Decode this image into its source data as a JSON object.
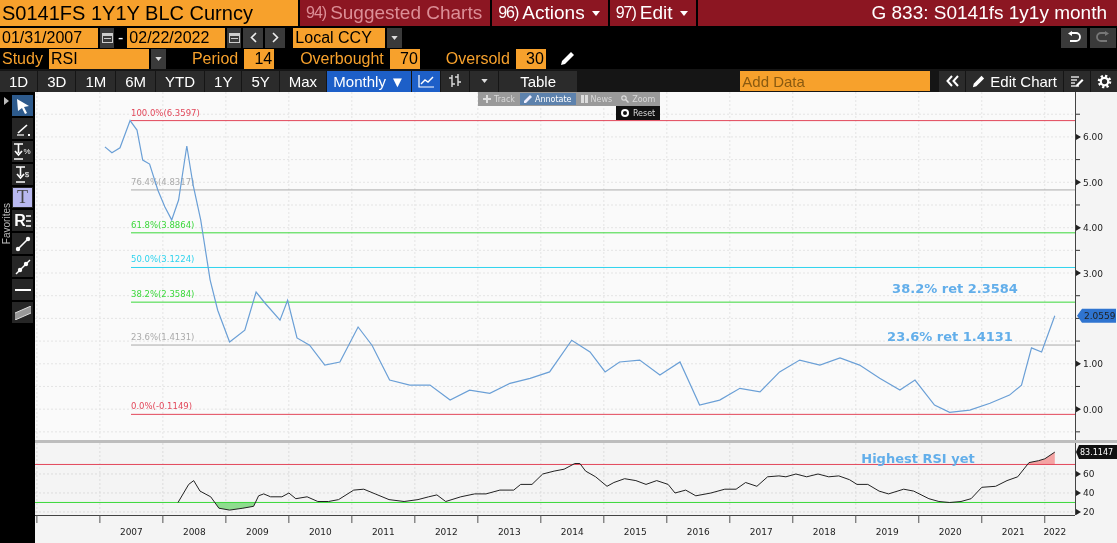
{
  "header": {
    "ticker": "S0141FS 1Y1Y BLC Curncy",
    "menus": [
      {
        "num": "94)",
        "label": "Suggested Charts",
        "disabled": true,
        "dropdown": false
      },
      {
        "num": "96)",
        "label": "Actions",
        "disabled": false,
        "dropdown": true
      },
      {
        "num": "97)",
        "label": "Edit",
        "disabled": false,
        "dropdown": true
      }
    ],
    "title": "G 833: S0141fs 1y1y month"
  },
  "dates": {
    "start": "01/31/2007",
    "separator": "-",
    "end": "02/22/2022",
    "currency": "Local CCY"
  },
  "study": {
    "label": "Study",
    "name": "RSI",
    "params": [
      {
        "label": "Period",
        "value": "14"
      },
      {
        "label": "Overbought",
        "value": "70"
      },
      {
        "label": "Oversold",
        "value": "30"
      }
    ]
  },
  "ranges": [
    {
      "label": "1D",
      "selected": false
    },
    {
      "label": "3D",
      "selected": false
    },
    {
      "label": "1M",
      "selected": false
    },
    {
      "label": "6M",
      "selected": false
    },
    {
      "label": "YTD",
      "selected": false
    },
    {
      "label": "1Y",
      "selected": false
    },
    {
      "label": "5Y",
      "selected": false
    },
    {
      "label": "Max",
      "selected": false
    }
  ],
  "frequency": {
    "label": "Monthly ▼",
    "selected": true
  },
  "chart_types": [
    {
      "kind": "line",
      "selected": true
    },
    {
      "kind": "bar",
      "selected": false
    }
  ],
  "table_button": "Table",
  "add_data": {
    "placeholder": "Add Data"
  },
  "edit_chart": "Edit Chart",
  "favorites": "Favorites",
  "tools": [
    {
      "kind": "pointer",
      "selected": true
    },
    {
      "kind": "pen",
      "selected": false
    },
    {
      "kind": "price",
      "glyph": "%",
      "selected": false
    },
    {
      "kind": "price",
      "glyph": "$",
      "selected": false
    },
    {
      "kind": "text",
      "glyph": "T",
      "selected": false
    },
    {
      "kind": "label",
      "glyph": "R",
      "selected": false
    },
    {
      "kind": "trend",
      "selected": false
    },
    {
      "kind": "ray",
      "selected": false
    },
    {
      "kind": "horizontal",
      "selected": false
    },
    {
      "kind": "channel",
      "selected": false
    }
  ],
  "chart_modes": [
    {
      "kind": "track",
      "label": "Track",
      "selected": false
    },
    {
      "kind": "annotate",
      "label": "Annotate",
      "selected": true
    },
    {
      "kind": "news",
      "label": "News",
      "selected": false
    },
    {
      "kind": "zoom",
      "label": "Zoom",
      "selected": false
    }
  ],
  "reset": "Reset",
  "main_chart": {
    "last_value": "2.0559",
    "chart_data": {
      "type": "line",
      "grid": true,
      "xlim": [
        2005.97,
        2022.48
      ],
      "ylim": [
        -0.68,
        6.99
      ],
      "yticks": [
        {
          "value": 0,
          "label": "0.00"
        },
        {
          "value": 1,
          "label": "1.00"
        },
        {
          "value": 3,
          "label": "3.00"
        },
        {
          "value": 4,
          "label": "4.00"
        },
        {
          "value": 5,
          "label": "5.00"
        },
        {
          "value": 6,
          "label": "6.00"
        }
      ],
      "x": [
        2007.08,
        2007.19,
        2007.32,
        2007.48,
        2007.59,
        2007.68,
        2007.79,
        2007.92,
        2008.03,
        2008.14,
        2008.25,
        2008.38,
        2008.48,
        2008.6,
        2008.75,
        2008.87,
        2009.06,
        2009.3,
        2009.48,
        2009.62,
        2009.86,
        2009.98,
        2010.13,
        2010.33,
        2010.57,
        2010.81,
        2011.1,
        2011.32,
        2011.6,
        2011.92,
        2012.24,
        2012.56,
        2012.87,
        2013.19,
        2013.51,
        2013.83,
        2014.14,
        2014.49,
        2014.78,
        2015.02,
        2015.25,
        2015.57,
        2015.89,
        2016.21,
        2016.52,
        2016.84,
        2017.16,
        2017.48,
        2017.79,
        2018.11,
        2018.43,
        2018.75,
        2019.06,
        2019.38,
        2019.7,
        2019.94,
        2020.25,
        2020.49,
        2020.81,
        2021.13,
        2021.44,
        2021.63,
        2021.79,
        2021.95,
        2022.16
      ],
      "series": [
        {
          "color": "#6a9fd6",
          "values": [
            5.78,
            5.65,
            5.76,
            6.36,
            6.15,
            5.49,
            5.4,
            4.83,
            4.46,
            4.17,
            4.61,
            5.8,
            4.94,
            4.17,
            2.85,
            2.18,
            1.48,
            1.74,
            2.58,
            2.34,
            1.96,
            2.4,
            1.57,
            1.41,
            0.97,
            1.04,
            1.81,
            1.41,
            0.64,
            0.53,
            0.53,
            0.2,
            0.42,
            0.35,
            0.57,
            0.68,
            0.82,
            1.52,
            1.26,
            0.82,
            1.04,
            1.08,
            0.75,
            1.04,
            0.09,
            0.2,
            0.46,
            0.38,
            0.82,
            1.08,
            0.97,
            1.13,
            0.97,
            0.68,
            0.42,
            0.64,
            0.09,
            -0.07,
            -0.02,
            0.13,
            0.31,
            0.53,
            1.35,
            1.26,
            2.06
          ]
        }
      ],
      "ref_lines": [
        {
          "axis": "y",
          "value": 6.3597,
          "label": "100.0%(6.3597)",
          "color": "#e2475a"
        },
        {
          "axis": "y",
          "value": 4.8317,
          "label": "76.4%(4.8317)",
          "color": "#aaaaaa"
        },
        {
          "axis": "y",
          "value": 3.8864,
          "label": "61.8%(3.8864)",
          "color": "#3ad83a"
        },
        {
          "axis": "y",
          "value": 3.1224,
          "label": "50.0%(3.1224)",
          "color": "#2fd3ee"
        },
        {
          "axis": "y",
          "value": 2.3584,
          "label": "38.2%(2.3584)",
          "color": "#3ad83a"
        },
        {
          "axis": "y",
          "value": 1.4131,
          "label": "23.6%(1.4131)",
          "color": "#aaaaaa"
        },
        {
          "axis": "y",
          "value": -0.1149,
          "label": "0.0%(-0.1149)",
          "color": "#e2475a"
        }
      ],
      "annotations": [
        "38.2% ret 2.3584",
        "23.6% ret 1.4131"
      ]
    }
  },
  "rsi_panel": {
    "last_value": "83.1147",
    "chart_data": {
      "type": "line",
      "xlim": [
        2005.97,
        2022.48
      ],
      "ylim": [
        16.8,
        92.6
      ],
      "yticks": [
        {
          "value": 20,
          "label": "20"
        },
        {
          "value": 40,
          "label": "40"
        },
        {
          "value": 60,
          "label": "60"
        }
      ],
      "xticks": [
        {
          "value": 2007.5,
          "label": "2007"
        },
        {
          "value": 2008.5,
          "label": "2008"
        },
        {
          "value": 2009.5,
          "label": "2009"
        },
        {
          "value": 2010.5,
          "label": "2010"
        },
        {
          "value": 2011.5,
          "label": "2011"
        },
        {
          "value": 2012.5,
          "label": "2012"
        },
        {
          "value": 2013.5,
          "label": "2013"
        },
        {
          "value": 2014.5,
          "label": "2014"
        },
        {
          "value": 2015.5,
          "label": "2015"
        },
        {
          "value": 2016.5,
          "label": "2016"
        },
        {
          "value": 2017.5,
          "label": "2017"
        },
        {
          "value": 2018.5,
          "label": "2018"
        },
        {
          "value": 2019.5,
          "label": "2019"
        },
        {
          "value": 2020.5,
          "label": "2020"
        },
        {
          "value": 2021.5,
          "label": "2021"
        },
        {
          "value": 2022.16,
          "label": "2022"
        }
      ],
      "x": [
        2008.24,
        2008.41,
        2008.49,
        2008.59,
        2008.76,
        2008.89,
        2009.06,
        2009.27,
        2009.44,
        2009.52,
        2009.6,
        2009.71,
        2009.89,
        2010.0,
        2010.11,
        2010.29,
        2010.46,
        2010.63,
        2010.79,
        2011.03,
        2011.19,
        2011.37,
        2011.59,
        2011.83,
        2012.05,
        2012.22,
        2012.35,
        2012.49,
        2012.73,
        2012.95,
        2013.13,
        2013.35,
        2013.57,
        2013.68,
        2013.86,
        2014.03,
        2014.21,
        2014.37,
        2014.54,
        2014.62,
        2014.71,
        2014.87,
        2015.05,
        2015.16,
        2015.33,
        2015.51,
        2015.67,
        2015.84,
        2016.02,
        2016.13,
        2016.3,
        2016.46,
        2016.7,
        2016.92,
        2017.1,
        2017.25,
        2017.43,
        2017.6,
        2017.78,
        2017.89,
        2018.05,
        2018.22,
        2018.4,
        2018.57,
        2018.73,
        2018.9,
        2019.02,
        2019.19,
        2019.37,
        2019.52,
        2019.76,
        2019.92,
        2020.16,
        2020.32,
        2020.49,
        2020.67,
        2020.83,
        2021.0,
        2021.22,
        2021.4,
        2021.57,
        2021.75,
        2021.9,
        2022.0,
        2022.16
      ],
      "series": [
        {
          "color": "#222222",
          "values": [
            30,
            49,
            53,
            42,
            36,
            24,
            22,
            24,
            26,
            37,
            39,
            36,
            36,
            40,
            34,
            36,
            31,
            31,
            33,
            43,
            44,
            39,
            33,
            31,
            33,
            36,
            38,
            31,
            36,
            39,
            39,
            43,
            43,
            49,
            49,
            60,
            63,
            65,
            71,
            71,
            63,
            57,
            47,
            51,
            55,
            53,
            49,
            53,
            49,
            40,
            43,
            37,
            40,
            44,
            44,
            51,
            47,
            57,
            58,
            57,
            60,
            57,
            60,
            57,
            58,
            54,
            49,
            49,
            42,
            39,
            44,
            42,
            34,
            31,
            30,
            31,
            34,
            46,
            47,
            53,
            57,
            72,
            74,
            76,
            83
          ]
        }
      ],
      "grid": true,
      "ref_lines": [
        {
          "axis": "y",
          "value": 70,
          "color": "#e2475a"
        },
        {
          "axis": "y",
          "value": 30,
          "color": "#3ad83a"
        }
      ],
      "annotations": [
        "Highest RSI yet"
      ]
    }
  }
}
